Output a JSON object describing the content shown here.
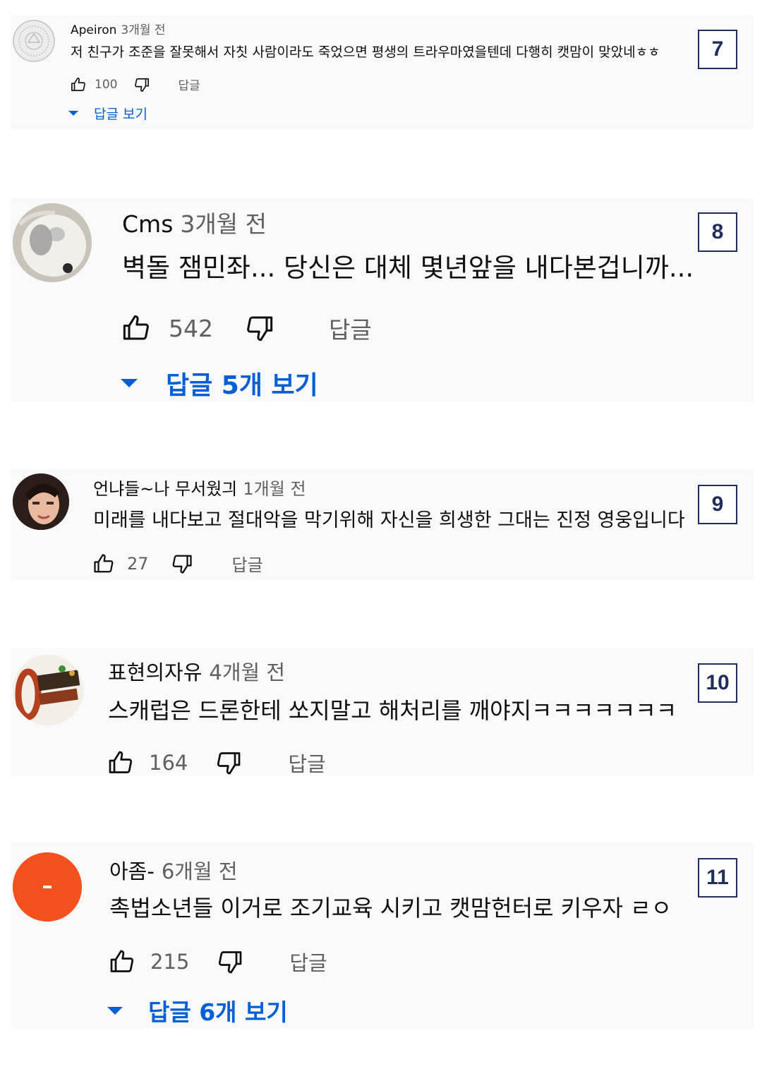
{
  "comments": [
    {
      "author": "Apeiron",
      "time": "3개월 전",
      "text": "저 친구가 조준을 잘못해서 자칫 사람이라도 죽었으면 평생의 트라우마였을텐데 다행히 캣맘이 맞았네ㅎㅎ",
      "likes": "100",
      "reply_label": "답글",
      "view_replies": "답글 보기",
      "badge": "7",
      "avatar": "emblem-avatar"
    },
    {
      "author": "Cms",
      "time": "3개월 전",
      "text": "벽돌 잼민좌... 당신은 대체 몇년앞을 내다본겁니까...",
      "likes": "542",
      "reply_label": "답글",
      "view_replies": "답글 5개 보기",
      "badge": "8",
      "avatar": "dog-avatar"
    },
    {
      "author": "언냐들~나 무서웠긔",
      "time": "1개월 전",
      "text": "미래를 내다보고 절대악을 막기위해 자신을 희생한 그대는 진정 영웅입니다",
      "likes": "27",
      "reply_label": "답글",
      "badge": "9",
      "avatar": "person-avatar"
    },
    {
      "author": "표현의자유",
      "time": "4개월 전",
      "text": "스캐럽은 드론한테 쏘지말고 해처리를 깨야지ㅋㅋㅋㅋㅋㅋㅋ",
      "likes": "164",
      "reply_label": "답글",
      "badge": "10",
      "avatar": "free-logo-avatar"
    },
    {
      "author": "아좀-",
      "time": "6개월 전",
      "text": "촉법소년들 이거로 조기교육 시키고 캣맘헌터로 키우자 ㄹㅇ",
      "likes": "215",
      "reply_label": "답글",
      "view_replies": "답글 6개 보기",
      "badge": "11",
      "avatar": "orange-dash-avatar"
    }
  ],
  "colors": {
    "card_bg": "#f9f9f9",
    "link_blue": "#065fd4",
    "meta_gray": "#606060",
    "badge_navy": "#1f2f5a",
    "orange_avatar": "#f4511e"
  },
  "icons": {
    "like": "thumbs-up-icon",
    "dislike": "thumbs-down-icon",
    "expand": "caret-down-icon"
  }
}
